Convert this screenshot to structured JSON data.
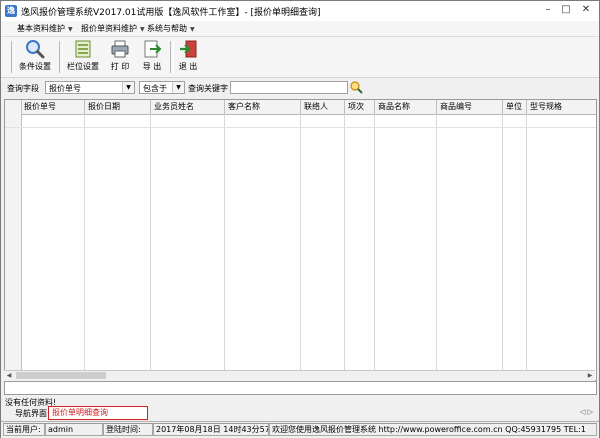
{
  "window": {
    "title": "逸风报价管理系统V2017.01试用版【逸风软件工作室】- [报价单明细查询]",
    "controls": [
      "–",
      "□",
      "✕"
    ]
  },
  "menu": [
    {
      "label": "基本资料维护"
    },
    {
      "label": "报价单资料维护"
    },
    {
      "label": "系统与帮助"
    }
  ],
  "toolbar": {
    "buttons": [
      {
        "label": "条件设置",
        "icon": "magnifier-icon"
      },
      {
        "label": "栏位设置",
        "icon": "columns-icon"
      },
      {
        "label": "打 印",
        "icon": "printer-icon"
      },
      {
        "label": "导 出",
        "icon": "export-icon"
      },
      {
        "label": "退 出",
        "icon": "exit-icon"
      }
    ]
  },
  "query": {
    "field_label": "查询字段",
    "field_value": "报价单号",
    "op_value": "包含于",
    "keyword_label": "查询关键字",
    "keyword_value": ""
  },
  "grid": {
    "columns": [
      "报价单号",
      "报价日期",
      "业务员姓名",
      "客户名称",
      "联络人",
      "项次",
      "商品名称",
      "商品编号",
      "单位",
      "型号规格"
    ]
  },
  "message": "没有任何资料!",
  "nav": {
    "label": "导航界面",
    "tab": "报价单明细查询"
  },
  "status": {
    "user_label": "当前用户:",
    "user": "admin",
    "login_label": "登陆时间:",
    "login_time": "2017年08月18日 14时43分57秒",
    "welcome": "欢迎您使用逸风报价管理系统 http://www.poweroffice.com.cn QQ:45931795 TEL:1"
  },
  "colors": {
    "nav_tab": "#d02020",
    "icon_blue": "#3a78c8"
  }
}
